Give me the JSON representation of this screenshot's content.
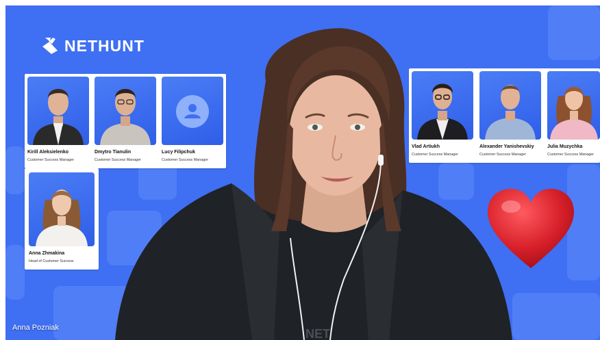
{
  "brand": {
    "name": "NetHunt"
  },
  "team_left": [
    {
      "name": "Kirill Aleksielenko",
      "role": "Customer Success Manager"
    },
    {
      "name": "Dmytro Tianulin",
      "role": "Customer Success Manager"
    },
    {
      "name": "Lucy Filipchuk",
      "role": "Customer Success Manager"
    }
  ],
  "team_lead": {
    "name": "Anna Zhmakina",
    "role": "Head of Customer Success"
  },
  "team_right": [
    {
      "name": "Vlad Artiukh",
      "role": "Customer Success Manager"
    },
    {
      "name": "Alexander Yanishevskiy",
      "role": "Customer Success Manager"
    },
    {
      "name": "Julia Muzychka",
      "role": "Customer Success Manager"
    }
  ],
  "participant": {
    "name": "Anna Pozniak"
  },
  "colors": {
    "background": "#3f6ff2",
    "square": "#5683f7",
    "heart": "#d7202a"
  },
  "icons": {
    "logo": "nethunt-logo-icon",
    "heart": "heart-icon",
    "placeholder": "user-placeholder-icon"
  }
}
